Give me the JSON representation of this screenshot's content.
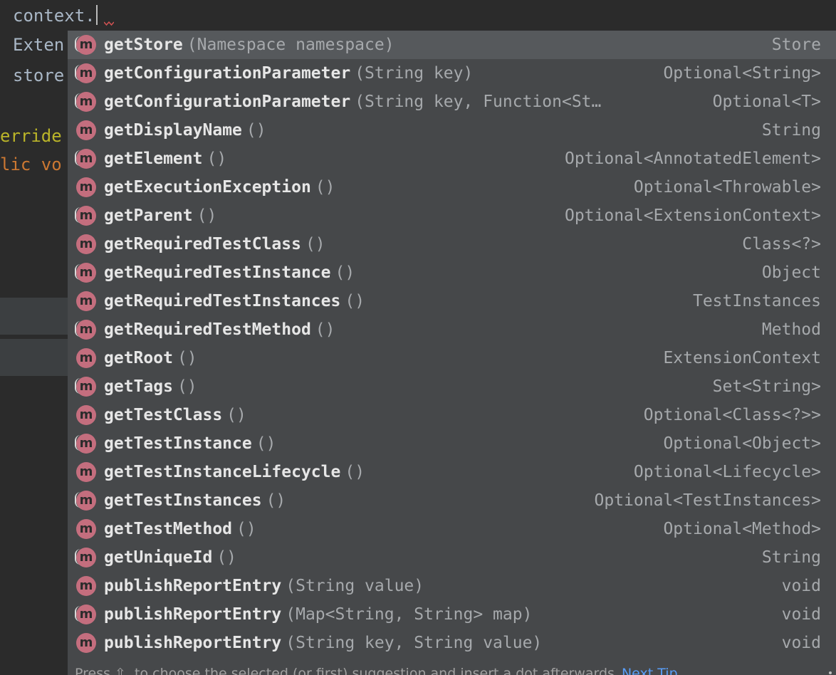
{
  "editor": {
    "lines": [
      "context.",
      "Exten",
      "store",
      "erride",
      "lic vo"
    ]
  },
  "completion": {
    "items": [
      {
        "name": "getStore",
        "params": "(Namespace namespace)",
        "type": "Store",
        "selected": true,
        "icon": "method-icon"
      },
      {
        "name": "getConfigurationParameter",
        "params": "(String key)",
        "type": "Optional<String>",
        "icon": "method-icon"
      },
      {
        "name": "getConfigurationParameter",
        "params": "(String key, Function<St…",
        "type": "Optional<T>",
        "icon": "method-icon"
      },
      {
        "name": "getDisplayName",
        "params": "()",
        "type": "String",
        "icon": "method-icon"
      },
      {
        "name": "getElement",
        "params": "()",
        "type": "Optional<AnnotatedElement>",
        "icon": "method-icon"
      },
      {
        "name": "getExecutionException",
        "params": "()",
        "type": "Optional<Throwable>",
        "icon": "method-icon"
      },
      {
        "name": "getParent",
        "params": "()",
        "type": "Optional<ExtensionContext>",
        "icon": "method-icon"
      },
      {
        "name": "getRequiredTestClass",
        "params": "()",
        "type": "Class<?>",
        "icon": "method-icon"
      },
      {
        "name": "getRequiredTestInstance",
        "params": "()",
        "type": "Object",
        "icon": "method-icon"
      },
      {
        "name": "getRequiredTestInstances",
        "params": "()",
        "type": "TestInstances",
        "icon": "method-icon"
      },
      {
        "name": "getRequiredTestMethod",
        "params": "()",
        "type": "Method",
        "icon": "method-icon"
      },
      {
        "name": "getRoot",
        "params": "()",
        "type": "ExtensionContext",
        "icon": "method-icon"
      },
      {
        "name": "getTags",
        "params": "()",
        "type": "Set<String>",
        "icon": "method-icon"
      },
      {
        "name": "getTestClass",
        "params": "()",
        "type": "Optional<Class<?>>",
        "icon": "method-icon"
      },
      {
        "name": "getTestInstance",
        "params": "()",
        "type": "Optional<Object>",
        "icon": "method-icon"
      },
      {
        "name": "getTestInstanceLifecycle",
        "params": "()",
        "type": "Optional<Lifecycle>",
        "icon": "method-icon"
      },
      {
        "name": "getTestInstances",
        "params": "()",
        "type": "Optional<TestInstances>",
        "icon": "method-icon"
      },
      {
        "name": "getTestMethod",
        "params": "()",
        "type": "Optional<Method>",
        "icon": "method-icon"
      },
      {
        "name": "getUniqueId",
        "params": "()",
        "type": "String",
        "icon": "method-icon"
      },
      {
        "name": "publishReportEntry",
        "params": "(String value)",
        "type": "void",
        "icon": "method-icon"
      },
      {
        "name": "publishReportEntry",
        "params": "(Map<String, String> map)",
        "type": "void",
        "icon": "method-icon"
      },
      {
        "name": "publishReportEntry",
        "params": "(String key, String value)",
        "type": "void",
        "icon": "method-icon"
      }
    ],
    "icon_letter": "m",
    "footer_text": "Press ⇧. to choose the selected (or first) suggestion and insert a dot afterwards",
    "footer_link": "Next Tip"
  },
  "colors": {
    "editor_bg": "#2b2b2b",
    "popup_bg": "#46484a",
    "selected_bg": "#56595c",
    "method_icon": "#c46e7e",
    "annotation": "#bbb529",
    "keyword": "#cc7832",
    "link": "#589df6"
  }
}
